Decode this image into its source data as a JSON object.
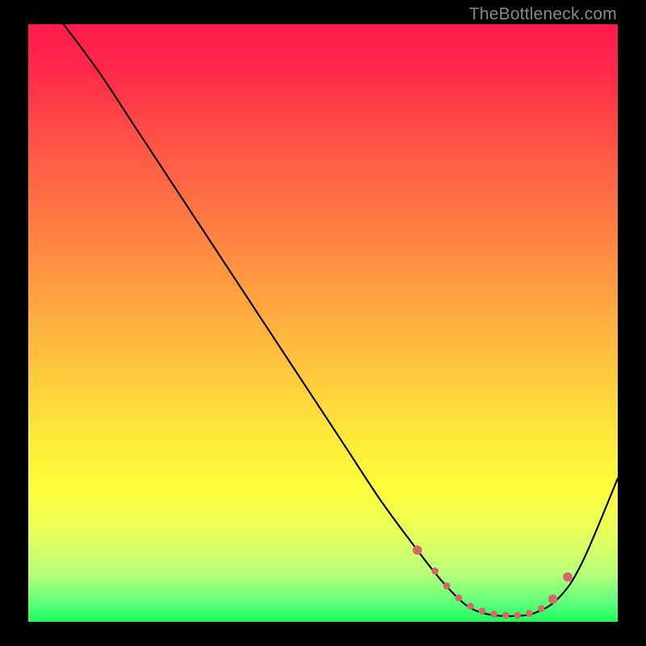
{
  "watermark": "TheBottleneck.com",
  "chart_data": {
    "type": "line",
    "title": "",
    "xlabel": "",
    "ylabel": "",
    "ylim": [
      0,
      100
    ],
    "xlim": [
      0,
      100
    ],
    "series": [
      {
        "name": "bottleneck-curve",
        "x": [
          6,
          12,
          18,
          24,
          30,
          36,
          42,
          48,
          54,
          60,
          66,
          70,
          74,
          77,
          80,
          83,
          86,
          90,
          94,
          100
        ],
        "values": [
          100,
          92,
          83,
          74,
          65,
          56,
          47,
          38,
          29,
          20,
          12,
          7,
          3,
          1.5,
          1,
          1,
          1.5,
          4,
          10,
          24
        ]
      }
    ],
    "markers": {
      "name": "valley-points",
      "color": "#d36a6a",
      "x": [
        66,
        69,
        71,
        73,
        75,
        77,
        79,
        81,
        83,
        85,
        87,
        89,
        91.5
      ],
      "values": [
        12,
        8.5,
        6,
        4,
        2.6,
        1.8,
        1.3,
        1.1,
        1.1,
        1.4,
        2.2,
        3.8,
        7.5
      ]
    }
  }
}
